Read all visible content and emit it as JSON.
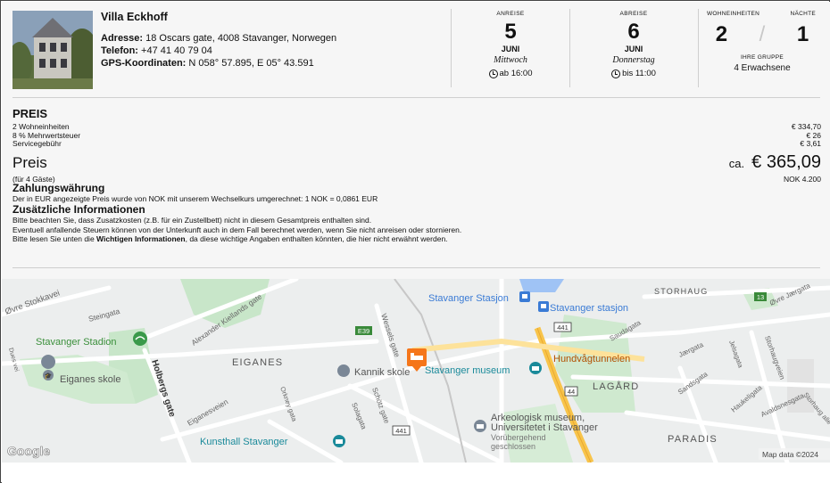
{
  "hotel": {
    "name": "Villa Eckhoff",
    "address_label": "Adresse:",
    "address": "18 Oscars gate, 4008 Stavanger, Norwegen",
    "phone_label": "Telefon:",
    "phone": "+47 41 40 79 04",
    "gps_label": "GPS-Koordinaten:",
    "gps": "N 058° 57.895, E 05° 43.591"
  },
  "arrival": {
    "caption": "ANREISE",
    "day": "5",
    "month": "JUNI",
    "weekday": "Mittwoch",
    "time": "ab 16:00"
  },
  "departure": {
    "caption": "ABREISE",
    "day": "6",
    "month": "JUNI",
    "weekday": "Donnerstag",
    "time": "bis 11:00"
  },
  "units": {
    "units_caption": "WOHNEINHEITEN",
    "nights_caption": "NÄCHTE",
    "units": "2",
    "separator": "/",
    "nights": "1",
    "group_caption": "IHRE GRUPPE",
    "group": "4 Erwachsene"
  },
  "price": {
    "title": "PREIS",
    "rows": [
      {
        "label": "2 Wohneinheiten",
        "value": "€ 334,70"
      },
      {
        "label": "8 % Mehrwertsteuer",
        "value": "€ 26"
      },
      {
        "label": "Servicegebühr",
        "value": "€ 3,61"
      }
    ],
    "total_label": "Preis",
    "total_prefix": "ca.",
    "total_value": "€ 365,09",
    "guests": "(für 4 Gäste)",
    "total_nok": "NOK 4.200"
  },
  "currency": {
    "title": "Zahlungswährung",
    "text": "Der in EUR angezeigte Preis wurde von NOK mit unserem Wechselkurs umgerechnet: 1 NOK = 0,0861 EUR"
  },
  "info": {
    "title": "Zusätzliche Informationen",
    "line1": "Bitte beachten Sie, dass Zusatzkosten (z.B. für ein Zustellbett) nicht in diesem Gesamtpreis enthalten sind.",
    "line2": "Eventuell anfallende Steuern können von der Unterkunft auch in dem Fall berechnet werden, wenn Sie nicht anreisen oder stornieren.",
    "line3_pre": "Bitte lesen Sie unten die ",
    "line3_bold": "Wichtigen Informationen",
    "line3_post": ", da diese wichtige Angaben enthalten könnten, die hier nicht erwähnt werden."
  },
  "map": {
    "labels": {
      "ovre_stokkavei": "Øvre Stokkavei",
      "steingata": "Steingata",
      "stadion": "Stavanger Stadion",
      "alexander": "Alexander Kiellands gate",
      "eiganes": "EIGANES",
      "eiganes_skole": "Eiganes skole",
      "holbergs": "Holbergs gate",
      "eiganesveien": "Eiganesveien",
      "dues_vei": "Dues vei",
      "orkne": "Orkney gata",
      "wessels": "Wessels gate",
      "e39": "E39",
      "kannik": "Kannik skole",
      "schotz": "Schötz gate",
      "solagata": "Solagata",
      "kunsthall": "Kunsthall Stavanger",
      "stasjon1": "Stavanger Stasjon",
      "stasjon2": "Stavanger stasjon",
      "museum": "Stavanger museum",
      "hundvag": "Hundvågtunnelen",
      "lagard": "LAGÅRD",
      "arkeologisk1": "Arkeologisk museum,",
      "arkeologisk2": "Universitetet i Stavanger",
      "closed1": "Vorübergehend",
      "closed2": "geschlossen",
      "paradis": "PARADIS",
      "storhaug": "STORHAUG",
      "saudagata": "Saudagata",
      "jaergata": "Jærgata",
      "sandsgata": "Sandsgata",
      "haukeligata": "Haukeligata",
      "avaldsnes": "Avaldsnesgata",
      "storhaugveien": "Storhaugveien",
      "storhaug_alle": "Storhaug alle",
      "ovre_jaergata": "Øvre Jærgata",
      "jelsagata": "Jelsagata",
      "r441a": "441",
      "r441b": "441",
      "r44": "44",
      "r13": "13",
      "google": "Google",
      "mapdata": "Map data ©2024"
    }
  }
}
